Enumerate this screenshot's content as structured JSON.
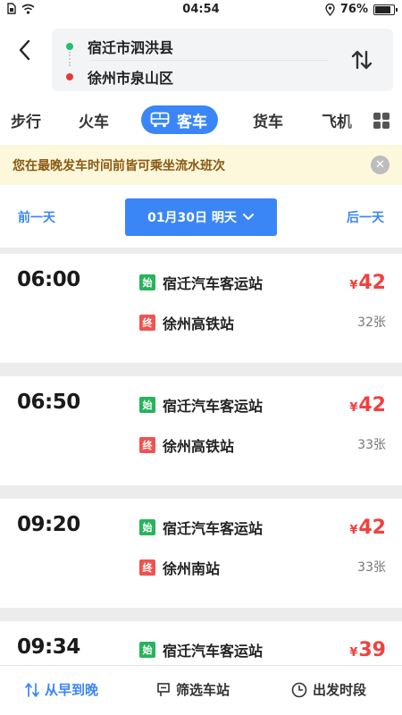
{
  "status_bar": {
    "time": "04:54",
    "battery": "76%",
    "battery_level": 0.76
  },
  "route": {
    "from": "宿迁市泗洪县",
    "to": "徐州市泉山区"
  },
  "tabs": [
    {
      "label": "步行",
      "active": false
    },
    {
      "label": "火车",
      "active": false
    },
    {
      "label": "客车",
      "active": true
    },
    {
      "label": "货车",
      "active": false
    },
    {
      "label": "飞机",
      "active": false
    }
  ],
  "notice": {
    "text": "您在最晚发车时间前皆可乘坐流水班次"
  },
  "date_bar": {
    "prev": "前一天",
    "date": "01月30日 明天",
    "next": "后一天"
  },
  "badges": {
    "start": "始",
    "end": "终",
    "currency": "¥"
  },
  "trips": [
    {
      "time": "06:00",
      "from": "宿迁汽车客运站",
      "to": "徐州高铁站",
      "price": "42",
      "seats": "32张"
    },
    {
      "time": "06:50",
      "from": "宿迁汽车客运站",
      "to": "徐州高铁站",
      "price": "42",
      "seats": "33张"
    },
    {
      "time": "09:20",
      "from": "宿迁汽车客运站",
      "to": "徐州南站",
      "price": "42",
      "seats": "33张"
    },
    {
      "time": "09:34",
      "from": "宿迁汽车客运站",
      "to": "",
      "price": "39",
      "seats": ""
    }
  ],
  "bottom_bar": {
    "sort": "从早到晚",
    "filter": "筛选车站",
    "depart": "出发时段"
  },
  "colors": {
    "accent": "#3b86f7",
    "price": "#f0413f",
    "start_badge": "#27b45a",
    "end_badge": "#ef5350",
    "notice_bg": "#fdf7dc"
  }
}
